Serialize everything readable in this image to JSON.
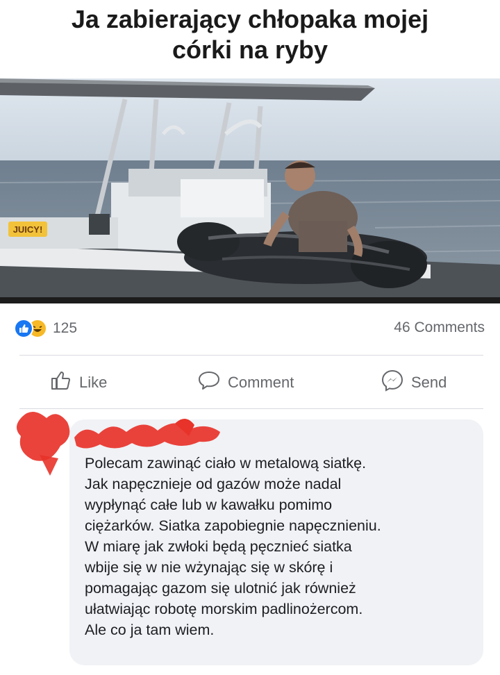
{
  "meme": {
    "title_line1": "Ja zabierający chłopaka mojej",
    "title_line2": "córki na ryby",
    "watermark": "JUICY!"
  },
  "post_stats": {
    "reaction_count": "125",
    "comments_count": "46 Comments",
    "reaction_icons": [
      "like-icon",
      "haha-icon"
    ]
  },
  "actions": {
    "like_label": "Like",
    "comment_label": "Comment",
    "send_label": "Send"
  },
  "comment": {
    "lines": [
      "Polecam zawinąć ciało w metalową siatkę.",
      "Jak napęcznieje od gazów może nadal",
      "wypłynąć całe lub w kawałku pomimo",
      "ciężarków. Siatka zapobiegnie napęcznieniu.",
      "W miarę jak zwłoki będą pęcznieć siatka",
      "wbije się w nie wżynając się w skórę i",
      "pomagając gazom się ulotnić jak również",
      "ułatwiając robotę morskim padlinożercom.",
      "Ale co ja tam wiem."
    ]
  },
  "colors": {
    "like_blue": "#1877f2",
    "haha_yellow": "#f7b928",
    "redaction_red": "#e8332a",
    "bubble_bg": "#f0f2f5",
    "muted_text": "#65676b"
  }
}
